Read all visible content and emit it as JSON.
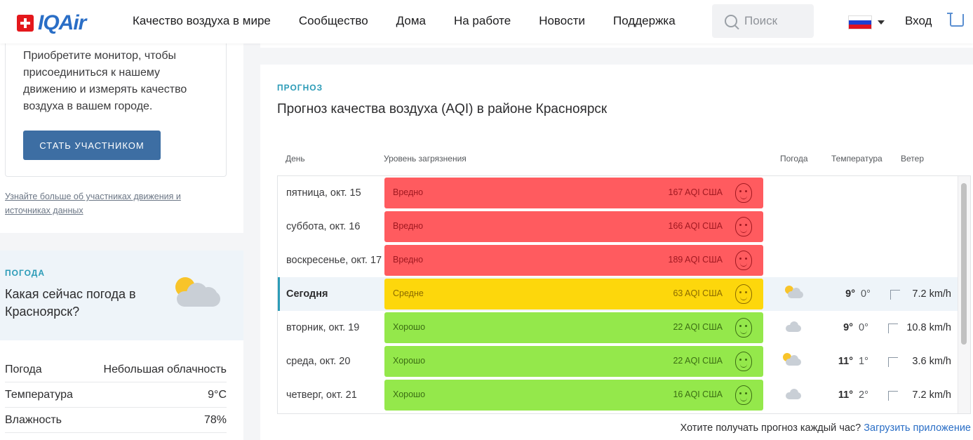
{
  "header": {
    "logo_text": "IQAir",
    "nav": [
      "Качество воздуха в мире",
      "Сообщество",
      "Дома",
      "На работе",
      "Новости",
      "Поддержка"
    ],
    "search_placeholder": "Поиск",
    "login_label": "Вход"
  },
  "join": {
    "text": "Приобретите монитор, чтобы присоединиться к нашему движению и измерять качество воздуха в вашем городе.",
    "button_label": "СТАТЬ УЧАСТНИКОМ",
    "learn_link": "Узнайте больше об участниках движения и источниках данных"
  },
  "weather": {
    "kicker": "ПОГОДА",
    "title": "Какая сейчас погода в Красноярск?",
    "rows": [
      {
        "label": "Погода",
        "value": "Небольшая облачность"
      },
      {
        "label": "Температура",
        "value": "9°C"
      },
      {
        "label": "Влажность",
        "value": "78%"
      }
    ]
  },
  "forecast": {
    "kicker": "ПРОГНОЗ",
    "title": "Прогноз качества воздуха (AQI) в районе Красноярск",
    "columns": {
      "day": "День",
      "pollution": "Уровень загрязнения",
      "weather": "Погода",
      "temperature": "Температура",
      "wind": "Ветер"
    },
    "rows": [
      {
        "day": "пятница, окт. 15",
        "level": "Вредно",
        "aqi": "167 AQI США",
        "color": "#ff5b5f",
        "text_color": "#a01820",
        "weather_icon": "",
        "tmax": "",
        "tmin": "",
        "wind": ""
      },
      {
        "day": "суббота, окт. 16",
        "level": "Вредно",
        "aqi": "166 AQI США",
        "color": "#ff5b5f",
        "text_color": "#a01820",
        "weather_icon": "",
        "tmax": "",
        "tmin": "",
        "wind": ""
      },
      {
        "day": "воскресенье, окт. 17",
        "level": "Вредно",
        "aqi": "189 AQI США",
        "color": "#ff5b5f",
        "text_color": "#a01820",
        "weather_icon": "",
        "tmax": "",
        "tmin": "",
        "wind": ""
      },
      {
        "day": "Сегодня",
        "level": "Средне",
        "aqi": "63 AQI США",
        "color": "#fdd70c",
        "text_color": "#8a6a00",
        "weather_icon": "partly-cloudy-icon",
        "tmax": "9°",
        "tmin": "0°",
        "wind": "7.2 km/h"
      },
      {
        "day": "вторник, окт. 19",
        "level": "Хорошо",
        "aqi": "22 AQI США",
        "color": "#94e84b",
        "text_color": "#3b6d13",
        "weather_icon": "cloud-icon",
        "tmax": "9°",
        "tmin": "0°",
        "wind": "10.8 km/h"
      },
      {
        "day": "среда, окт. 20",
        "level": "Хорошо",
        "aqi": "22 AQI США",
        "color": "#94e84b",
        "text_color": "#3b6d13",
        "weather_icon": "partly-cloudy-icon",
        "tmax": "11°",
        "tmin": "1°",
        "wind": "3.6 km/h"
      },
      {
        "day": "четверг, окт. 21",
        "level": "Хорошо",
        "aqi": "16 AQI США",
        "color": "#94e84b",
        "text_color": "#3b6d13",
        "weather_icon": "cloud-icon",
        "tmax": "11°",
        "tmin": "2°",
        "wind": "7.2 km/h"
      }
    ],
    "footer_text": "Хотите получать прогноз каждый час?",
    "footer_link": "Загрузить приложение"
  },
  "colors": {
    "accent": "#2b9bb7",
    "brand_blue": "#2a6ec6",
    "button": "#3d6ea3"
  }
}
